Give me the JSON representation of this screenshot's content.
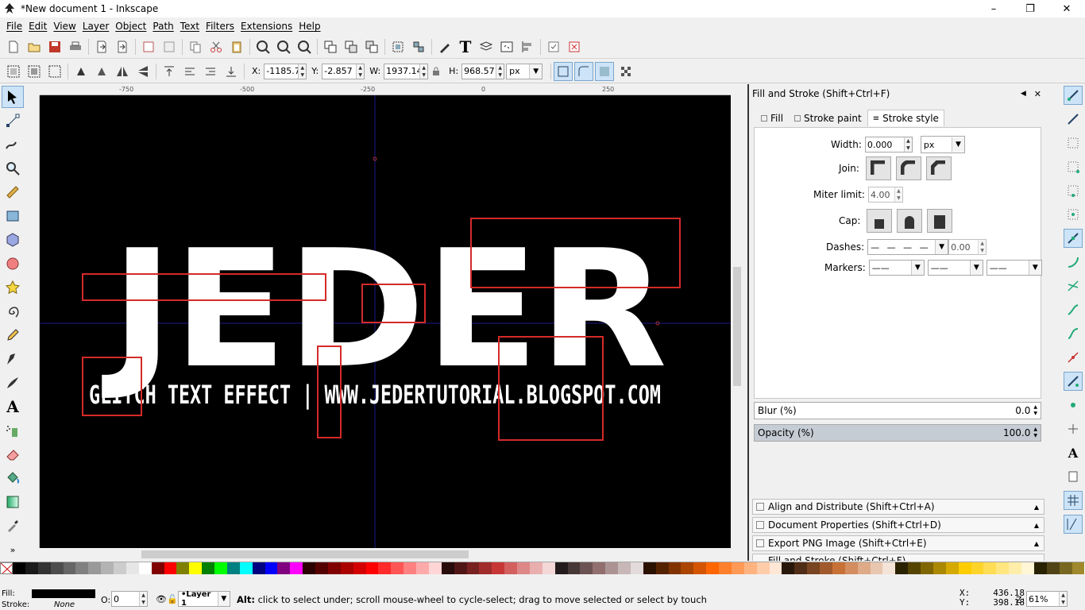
{
  "window": {
    "title": "*New document 1 - Inkscape"
  },
  "menu": [
    "File",
    "Edit",
    "View",
    "Layer",
    "Object",
    "Path",
    "Text",
    "Filters",
    "Extensions",
    "Help"
  ],
  "toolbar": {
    "x_label": "X:",
    "x_value": "-1185.7",
    "y_label": "Y:",
    "y_value": "-2.857",
    "w_label": "W:",
    "w_value": "1937.14",
    "h_label": "H:",
    "h_value": "968.571",
    "unit": "px"
  },
  "ruler": {
    "ticks": [
      "-750",
      "-500",
      "-250",
      "0",
      "250"
    ]
  },
  "canvas": {
    "headline": "JEDER",
    "subline": "GLITCH TEXT EFFECT | WWW.JEDERTUTORIAL.BLOGSPOT.COM",
    "colors": {
      "background": "#000000",
      "text": "#ffffff",
      "glitch_boxes": "#d42a2a",
      "guide": "#1a1a8a"
    }
  },
  "dock": {
    "title": "Fill and Stroke (Shift+Ctrl+F)",
    "tabs": [
      "Fill",
      "Stroke paint",
      "Stroke style"
    ],
    "active_tab": "Stroke style",
    "width_label": "Width:",
    "width_value": "0.000",
    "width_unit": "px",
    "join_label": "Join:",
    "miter_label": "Miter limit:",
    "miter_value": "4.00",
    "cap_label": "Cap:",
    "dashes_label": "Dashes:",
    "dashes_value": "0.00",
    "markers_label": "Markers:",
    "blur_label": "Blur (%)",
    "blur_value": "0.0",
    "opacity_label": "Opacity (%)",
    "opacity_value": "100.0",
    "collapsed": [
      "Align and Distribute (Shift+Ctrl+A)",
      "Document Properties (Shift+Ctrl+D)",
      "Export PNG Image (Shift+Ctrl+E)"
    ],
    "partial": "Fill and Stroke (Shift+Ctrl+F)"
  },
  "status": {
    "fill_label": "Fill:",
    "stroke_label": "Stroke:",
    "stroke_value": "None",
    "opacity_label": "O:",
    "opacity_value": "0",
    "layer": "•Layer 1",
    "message_key": "Alt:",
    "message": " click to select under; scroll mouse-wheel to cycle-select; drag to move selected or select by touch",
    "x_label": "X:",
    "x_value": "436.18",
    "y_label": "Y:",
    "y_value": "398.18",
    "zoom_label": "Z:",
    "zoom_value": "61%"
  },
  "palette": [
    "#000000",
    "#1a1a1a",
    "#333333",
    "#4d4d4d",
    "#666666",
    "#808080",
    "#999999",
    "#b3b3b3",
    "#cccccc",
    "#e6e6e6",
    "#ffffff",
    "#800000",
    "#ff0000",
    "#808000",
    "#ffff00",
    "#008000",
    "#00ff00",
    "#008080",
    "#00ffff",
    "#000080",
    "#0000ff",
    "#800080",
    "#ff00ff",
    "#2b0000",
    "#550000",
    "#800000",
    "#aa0000",
    "#d40000",
    "#ff0000",
    "#ff2a2a",
    "#ff5555",
    "#ff8080",
    "#ffaaaa",
    "#ffd5d5",
    "#280b0b",
    "#501616",
    "#782121",
    "#a02c2c",
    "#c83737",
    "#d35f5f",
    "#de8787",
    "#e9afaf",
    "#f4d7d7",
    "#241c1c",
    "#483737",
    "#6c5353",
    "#916f6f",
    "#ac9393",
    "#c8b7b7",
    "#e3dbdb",
    "#2b1100",
    "#552200",
    "#803300",
    "#aa4400",
    "#d45500",
    "#ff6600",
    "#ff7f2a",
    "#ff9955",
    "#ffb380",
    "#ffccaa",
    "#ffe6d5",
    "#28170b",
    "#502d16",
    "#784421",
    "#a05a2c",
    "#c87137",
    "#d38d5f",
    "#deaa87",
    "#e9c6af",
    "#f4e3d7",
    "#2b2200",
    "#554400",
    "#806600",
    "#aa8800",
    "#d4aa00",
    "#ffcc00",
    "#ffd42a",
    "#ffdd55",
    "#ffe680",
    "#ffeeaa",
    "#fff6d5",
    "#282200",
    "#504416",
    "#786721",
    "#a0892c"
  ]
}
